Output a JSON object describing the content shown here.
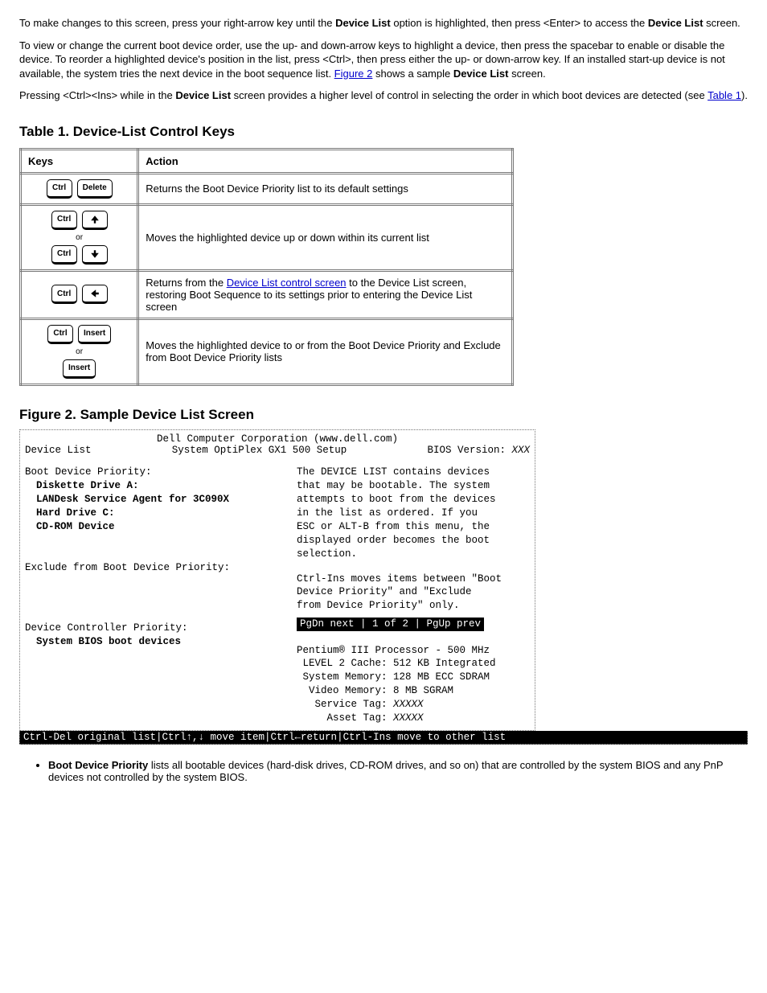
{
  "intro": {
    "p1_a": "To make changes to this screen, press your right-arrow key until the ",
    "p1_b": "Device List",
    "p1_c": " option is highlighted, then press <Enter> to access the ",
    "p1_d": "Device List",
    "p1_e": " screen.",
    "p2_a": "To view or change the current boot device order, use the up- and down-arrow keys to highlight a device, then press the spacebar to enable or disable the device. To reorder a highlighted device's position in the list, press <Ctrl>, then press either the up- or down-arrow key. If an installed start-up device is not available, the system tries the next device in the boot sequence list. ",
    "p2_link": "Figure 2",
    "p2_b": " shows a sample ",
    "p2_c": "Device List",
    "p2_d": " screen.",
    "p3_a": "Pressing <Ctrl><Ins> while in the ",
    "p3_b": "Device List",
    "p3_c": " screen provides a higher level of control in selecting the order in which boot devices are detected (see ",
    "p3_tbl_link": "Table 1",
    "p3_d": ")."
  },
  "table": {
    "caption": "Table 1. Device-List Control Keys",
    "h1": "Keys",
    "h2": "Action",
    "rows": [
      {
        "keys": [
          [
            "Ctrl",
            "Delete"
          ]
        ],
        "action": "Returns the Boot Device Priority list to its default settings"
      },
      {
        "keys": [
          [
            "Ctrl",
            "up"
          ],
          [
            "Ctrl",
            "down"
          ]
        ],
        "action": "Moves the highlighted device up or down within its current list"
      },
      {
        "keys": [
          [
            "Ctrl",
            "left"
          ]
        ],
        "action_a": "Returns from the ",
        "action_link": "Device List control screen",
        "action_b": " to the Device List screen, restoring Boot Sequence to its settings prior to entering the Device List screen"
      },
      {
        "keys": [
          [
            "Ctrl",
            "Insert"
          ],
          [
            "Insert"
          ]
        ],
        "action": "Moves the highlighted device to or from the Boot Device Priority and Exclude from Boot Device Priority lists"
      }
    ]
  },
  "fig_caption": "Figure 2. Sample Device List Screen",
  "bios": {
    "corp": "Dell Computer Corporation (www.dell.com)",
    "left_title": "Device List",
    "center_title": "System OptiPlex GX1 500 Setup",
    "right_title_a": "BIOS Version: ",
    "right_title_b": "XXX",
    "left_col": {
      "h1": "Boot Device Priority:",
      "items": [
        "Diskette Drive A:",
        "LANDesk Service Agent for 3C090X",
        "Hard Drive C:",
        "CD-ROM Device"
      ],
      "h2": "Exclude from Boot Device Priority:",
      "h3": "Device Controller Priority:",
      "item3": "System BIOS boot devices"
    },
    "right_col": {
      "para1": "The DEVICE LIST contains devices\nthat may be bootable. The system\nattempts to boot from the devices\nin the list as ordered. If you\nESC or ALT-B from this menu, the\ndisplayed order becomes the boot\nselection.",
      "para2": "Ctrl-Ins moves items between \"Boot\nDevice Priority\" and \"Exclude\nfrom Device Priority\" only.",
      "pager": " PgDn next | 1 of 2 | PgUp prev ",
      "sys0": "Pentium® III Processor - 500 MHz",
      "sys1": " LEVEL 2 Cache: 512 KB Integrated",
      "sys2": " System Memory: 128 MB ECC SDRAM",
      "sys3": "  Video Memory: 8 MB SGRAM",
      "sys4a": "   Service Tag: ",
      "sys4b": "XXXXX",
      "sys5a": "     Asset Tag: ",
      "sys5b": "XXXXX"
    },
    "footer": "Ctrl-Del original list|Ctrl↑,↓ move item|Ctrl←return|Ctrl-Ins move to other list"
  },
  "notes": {
    "n1_a": "Boot Device Priority",
    "n1_b": " lists all bootable devices (hard-disk drives, CD-ROM drives, and so on) that are controlled by the system BIOS and any PnP devices not controlled by the system BIOS."
  },
  "key_labels": {
    "ctrl": "Ctrl",
    "del": "Delete",
    "ins": "Insert",
    "or": "or"
  }
}
